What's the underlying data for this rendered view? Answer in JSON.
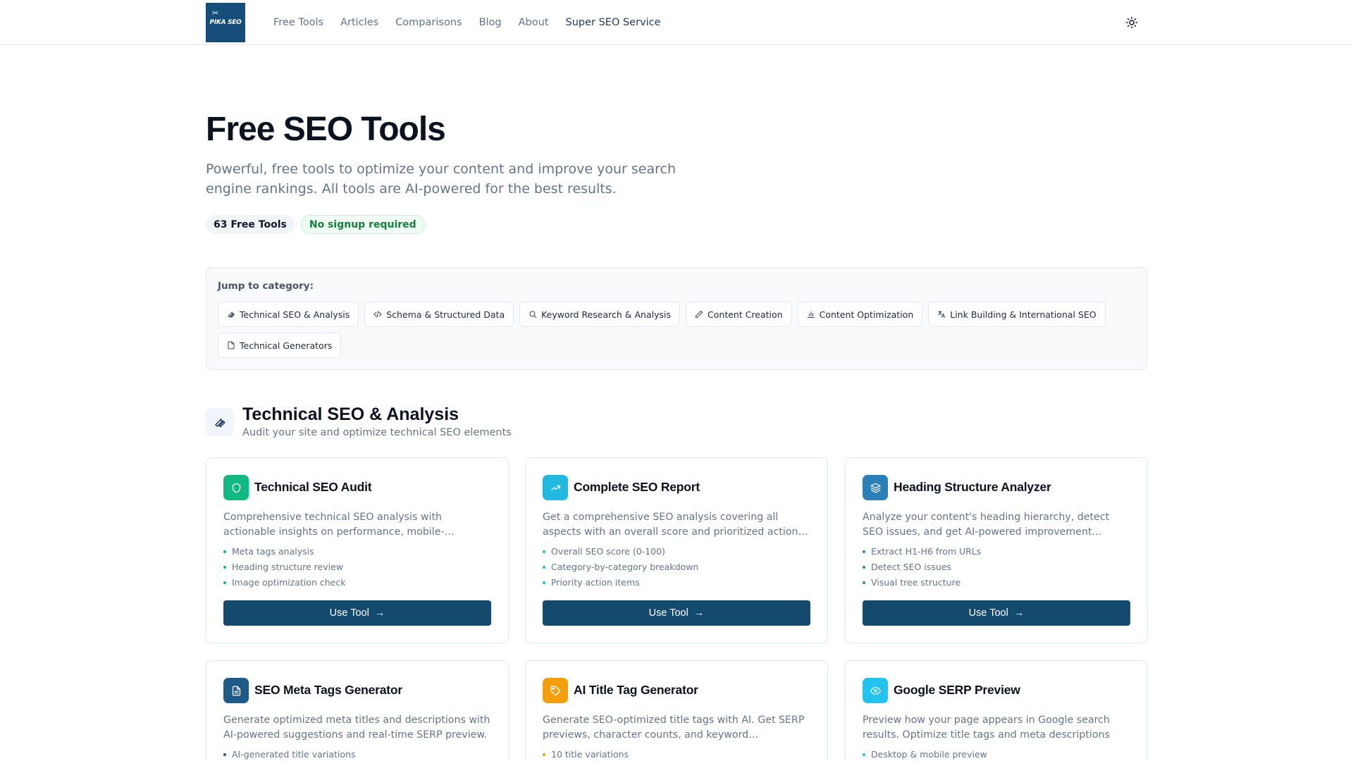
{
  "header": {
    "logo_text": "PIKA SEO",
    "nav": [
      "Free Tools",
      "Articles",
      "Comparisons",
      "Blog",
      "About",
      "Super SEO Service"
    ],
    "accent_color": "#164e7a"
  },
  "hero": {
    "title": "Free SEO Tools",
    "subtitle": "Powerful, free tools to optimize your content and improve your search engine rankings. All tools are AI-powered for the best results.",
    "badge_count": "63 Free Tools",
    "badge_nosignup": "No signup required"
  },
  "jump": {
    "label": "Jump to category:",
    "chips": [
      {
        "label": "Technical SEO & Analysis",
        "icon": "wrench-icon"
      },
      {
        "label": "Schema & Structured Data",
        "icon": "code-icon"
      },
      {
        "label": "Keyword Research & Analysis",
        "icon": "search-icon"
      },
      {
        "label": "Content Creation",
        "icon": "pencil-icon"
      },
      {
        "label": "Content Optimization",
        "icon": "bar-chart-icon"
      },
      {
        "label": "Link Building & International SEO",
        "icon": "languages-icon"
      },
      {
        "label": "Technical Generators",
        "icon": "file-icon"
      }
    ]
  },
  "section": {
    "title": "Technical SEO & Analysis",
    "subtitle": "Audit your site and optimize technical SEO elements",
    "icon": "wrench-icon"
  },
  "cards": [
    {
      "title": "Technical SEO Audit",
      "description": "Comprehensive technical SEO analysis with actionable insights on performance, mobile-…",
      "features": [
        "Meta tags analysis",
        "Heading structure review",
        "Image optimization check"
      ],
      "button": "Use Tool",
      "icon": "shield-icon",
      "color": "#10b981"
    },
    {
      "title": "Complete SEO Report",
      "description": "Get a comprehensive SEO analysis covering all aspects with an overall score and prioritized action…",
      "features": [
        "Overall SEO score (0-100)",
        "Category-by-category breakdown",
        "Priority action items"
      ],
      "button": "Use Tool",
      "icon": "trending-up-icon",
      "color": "#22b8e0"
    },
    {
      "title": "Heading Structure Analyzer",
      "description": "Analyze your content's heading hierarchy, detect SEO issues, and get AI-powered improvement…",
      "features": [
        "Extract H1-H6 from URLs",
        "Detect SEO issues",
        "Visual tree structure"
      ],
      "button": "Use Tool",
      "icon": "layers-icon",
      "color": "#2b7fb8"
    },
    {
      "title": "SEO Meta Tags Generator",
      "description": "Generate optimized meta titles and descriptions with AI-powered suggestions and real-time SERP preview.",
      "features": [
        "AI-generated title variations"
      ],
      "icon": "document-icon",
      "color": "#1e5a8a"
    },
    {
      "title": "AI Title Tag Generator",
      "description": "Generate SEO-optimized title tags with AI. Get SERP previews, character counts, and keyword…",
      "features": [
        "10 title variations"
      ],
      "icon": "tag-icon",
      "color": "#f59e0b"
    },
    {
      "title": "Google SERP Preview",
      "description": "Preview how your page appears in Google search results. Optimize title tags and meta descriptions fo…",
      "features": [
        "Desktop & mobile preview"
      ],
      "icon": "eye-icon",
      "color": "#22c3ee"
    }
  ]
}
